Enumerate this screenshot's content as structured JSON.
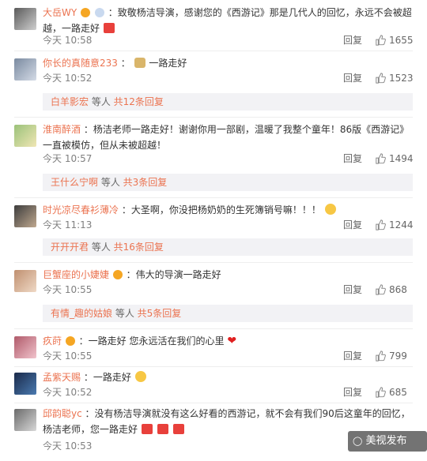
{
  "comments": [
    {
      "name": "大岳WY",
      "text": "：致敬杨洁导演，感谢您的《西游记》那是几代人的回忆，永远不会被超",
      "text2": "越，一路走好",
      "time": "今天 10:58",
      "reply": "回复",
      "likes": "1655"
    },
    {
      "name": "你长的真随意233",
      "text": "：",
      "text_tail": "一路走好",
      "time": "今天 10:52",
      "reply": "回复",
      "likes": "1523",
      "sub": {
        "user": "白羊影宏",
        "mid": " 等人 ",
        "count": "共12条回复"
      }
    },
    {
      "name": "淮南醉酒",
      "text": "：杨洁老师一路走好！谢谢你用一部剧，温暖了我整个童年！86版《西游记》",
      "text2": "一直被模仿，但从未被超越！",
      "time": "今天 10:57",
      "reply": "回复",
      "likes": "1494",
      "sub": {
        "user": "王什么宁啊",
        "mid": " 等人 ",
        "count": "共3条回复"
      }
    },
    {
      "name": "时光凉尽春衫薄冷",
      "text": "：大圣啊，你没把杨奶奶的生死簿销号嘛！！！",
      "time": "今天 11:13",
      "reply": "回复",
      "likes": "1244",
      "sub": {
        "user": "开开开君",
        "mid": " 等人 ",
        "count": "共16条回复"
      }
    },
    {
      "name": "巨蟹座的小婕婕",
      "text": "：伟大的导演一路走好",
      "time": "今天 10:55",
      "reply": "回复",
      "likes": "868",
      "sub": {
        "user": "有情_趣的姑娘",
        "mid": " 等人 ",
        "count": "共5条回复"
      }
    },
    {
      "name": "疚莳",
      "text": "：一路走好 您永远活在我们的心里",
      "time": "今天 10:55",
      "reply": "回复",
      "likes": "799"
    },
    {
      "name": "孟紫天赐",
      "text": "：一路走好",
      "time": "今天 10:52",
      "reply": "回复",
      "likes": "685"
    },
    {
      "name": "邱韵聪yc",
      "text": "：没有杨洁导演就没有这么好看的西游记，就不会有我们90后这童年的回忆，",
      "text2": "杨洁老师，您一路走好",
      "time": "今天 10:53",
      "reply": "回复",
      "likes": ""
    }
  ],
  "watermark": "美视发布",
  "colors": {
    "name": "#eb7350",
    "time": "#808080",
    "sub_bg": "#f2f2f5"
  }
}
